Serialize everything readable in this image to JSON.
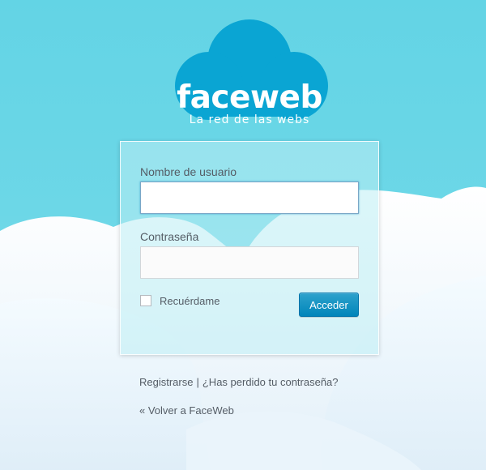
{
  "logo": {
    "title": "faceweb",
    "tagline": "La red de las webs"
  },
  "login_form": {
    "username_label": "Nombre de usuario",
    "username_value": "",
    "password_label": "Contraseña",
    "password_value": "",
    "remember_label": "Recuérdame",
    "remember_checked": false,
    "submit_label": "Acceder"
  },
  "links": {
    "register_label": "Registrarse",
    "separator": "|",
    "lost_password_label": "¿Has perdido tu contraseña?",
    "back_label": "« Volver a FaceWeb"
  },
  "colors": {
    "sky": "#63d4e5",
    "logo_cloud": "#0aa5d3",
    "button": "#0085ba",
    "text": "#555d66"
  }
}
